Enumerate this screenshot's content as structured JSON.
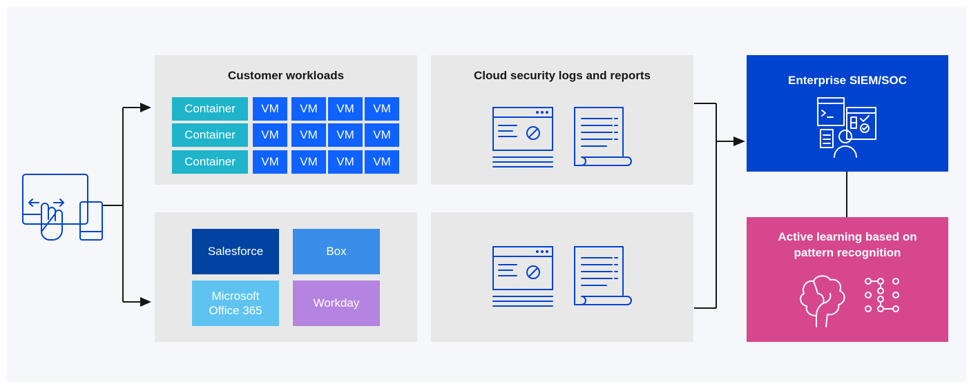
{
  "workloads": {
    "title": "Customer workloads",
    "rows": [
      {
        "container": "Container",
        "vms": [
          "VM",
          "VM",
          "VM",
          "VM"
        ]
      },
      {
        "container": "Container",
        "vms": [
          "VM",
          "VM",
          "VM",
          "VM"
        ]
      },
      {
        "container": "Container",
        "vms": [
          "VM",
          "VM",
          "VM",
          "VM"
        ]
      }
    ]
  },
  "saas": {
    "apps": [
      "Salesforce",
      "Box",
      "Microsoft Office 365",
      "Workday"
    ],
    "colors": [
      "#0043a0",
      "#3a8de8",
      "#5ec3f0",
      "#b583e0"
    ]
  },
  "logs": {
    "title": "Cloud security logs and reports"
  },
  "siem": {
    "title": "Enterprise SIEM/SOC"
  },
  "learning": {
    "title": "Active learning based on pattern recognition"
  },
  "colors": {
    "container": "#1fb4c9",
    "vm": "#0f62fe",
    "siem": "#0043ce",
    "learning": "#d6478e",
    "panel": "#e8e8e8",
    "line": "#161616",
    "icon": "#0043ce"
  }
}
